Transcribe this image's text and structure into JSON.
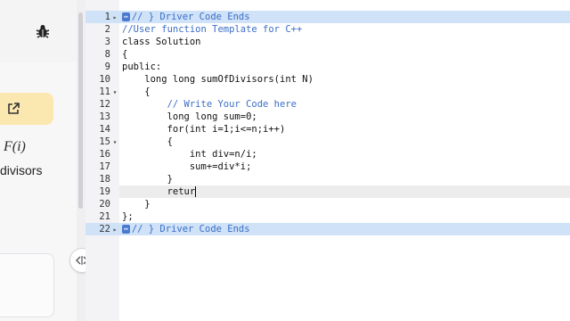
{
  "left_panel": {
    "fi_label": "F(i)",
    "divisors_label": "divisors"
  },
  "editor": {
    "lines": [
      {
        "num": "1",
        "fold": "▸",
        "text": "// } Driver Code Ends",
        "style": "hl",
        "marker": "↔"
      },
      {
        "num": "2",
        "fold": "",
        "text": "//User function Template for C++",
        "style": "comment"
      },
      {
        "num": "3",
        "fold": "",
        "text": "class Solution",
        "style": "plain"
      },
      {
        "num": "8",
        "fold": "",
        "text": "{",
        "style": "plain"
      },
      {
        "num": "9",
        "fold": "",
        "text": "public:",
        "style": "plain"
      },
      {
        "num": "10",
        "fold": "",
        "text": "    long long sumOfDivisors(int N)",
        "style": "plain"
      },
      {
        "num": "11",
        "fold": "▾",
        "text": "    {",
        "style": "plain"
      },
      {
        "num": "12",
        "fold": "",
        "text": "        // Write Your Code here",
        "style": "comment"
      },
      {
        "num": "13",
        "fold": "",
        "text": "        long long sum=0;",
        "style": "plain"
      },
      {
        "num": "14",
        "fold": "",
        "text": "        for(int i=1;i<=n;i++)",
        "style": "plain"
      },
      {
        "num": "15",
        "fold": "▾",
        "text": "        {",
        "style": "plain"
      },
      {
        "num": "16",
        "fold": "",
        "text": "            int div=n/i;",
        "style": "plain"
      },
      {
        "num": "17",
        "fold": "",
        "text": "            sum+=div*i;",
        "style": "plain"
      },
      {
        "num": "18",
        "fold": "",
        "text": "        }",
        "style": "plain"
      },
      {
        "num": "19",
        "fold": "",
        "text": "        retur",
        "style": "active"
      },
      {
        "num": "20",
        "fold": "",
        "text": "    }",
        "style": "plain"
      },
      {
        "num": "21",
        "fold": "",
        "text": "};",
        "style": "plain"
      },
      {
        "num": "22",
        "fold": "▸",
        "text": "// } Driver Code Ends",
        "style": "hl",
        "marker": "↔"
      }
    ]
  },
  "colors": {
    "highlight_band": "#cfe2f8",
    "comment": "#3b6ec6",
    "type_keyword": "#0000c8",
    "external_button": "#fbe7b0"
  },
  "icons": {
    "debug": "bug-icon",
    "external": "external-link-icon",
    "resize": "resize-handle-icon"
  }
}
